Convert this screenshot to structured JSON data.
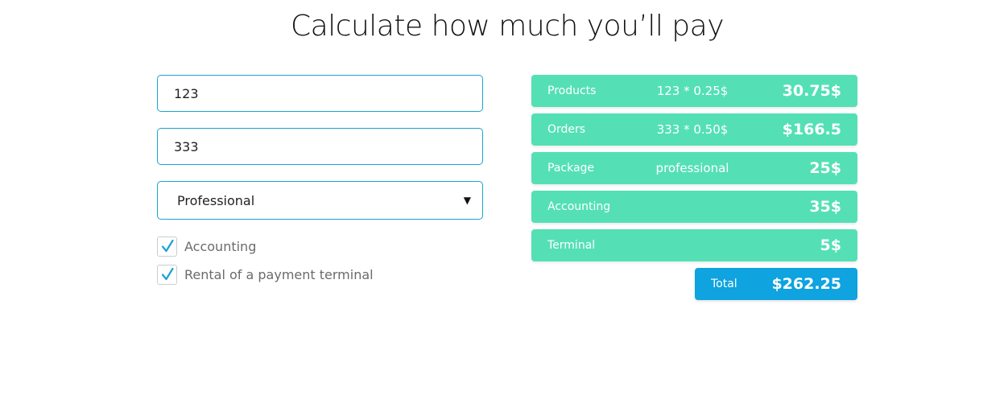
{
  "title": "Calculate how much you’ll pay",
  "form": {
    "products_value": "123",
    "orders_value": "333",
    "package_selected": "Professional",
    "checkboxes": [
      {
        "label": "Accounting",
        "checked": true
      },
      {
        "label": "Rental of a payment terminal",
        "checked": true
      }
    ]
  },
  "summary": {
    "rows": [
      {
        "label": "Products",
        "formula": "123 * 0.25$",
        "amount": "30.75$"
      },
      {
        "label": "Orders",
        "formula": "333 * 0.50$",
        "amount": "$166.5"
      },
      {
        "label": "Package",
        "formula": "professional",
        "amount": "25$"
      },
      {
        "label": "Accounting",
        "formula": "",
        "amount": "35$"
      },
      {
        "label": "Terminal",
        "formula": "",
        "amount": "5$"
      }
    ],
    "total_label": "Total",
    "total_amount": "$262.25"
  },
  "colors": {
    "row_bg": "#54e0b4",
    "total_bg": "#0fa3df",
    "input_border": "#1aa3d1",
    "check_mark": "#1aa3d1"
  },
  "icons": {
    "select_arrow": "caret-down-icon",
    "check": "checkmark-icon"
  }
}
